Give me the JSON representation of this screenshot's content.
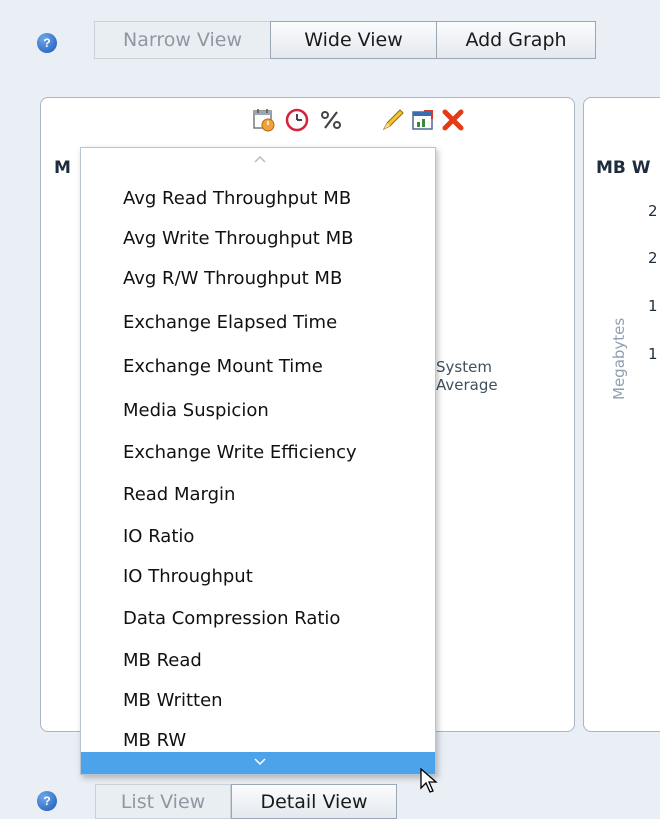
{
  "toolbar": {
    "help": "?",
    "narrow_view": "Narrow View",
    "wide_view": "Wide View",
    "add_graph": "Add Graph"
  },
  "left_panel": {
    "title_fragment": "M"
  },
  "right_panel": {
    "title_fragment": "MB W",
    "axis_label": "Megabytes",
    "tick_values": [
      "2",
      "2",
      "1",
      "1"
    ]
  },
  "legend_fragment": {
    "line1": "System",
    "line2": "Average"
  },
  "icons": [
    "calendar-icon",
    "clock-icon",
    "percent-icon",
    "pencil-icon",
    "export-icon",
    "delete-icon"
  ],
  "dropdown": {
    "scroll_up": "^",
    "scroll_down": "v",
    "items": [
      "Avg Read Throughput MB",
      "Avg Write Throughput MB",
      "Avg R/W Throughput MB",
      "Exchange Elapsed Time",
      "Exchange Mount Time",
      "Media Suspicion",
      "Exchange Write Efficiency",
      "Read Margin",
      "IO Ratio",
      "IO Throughput",
      "Data Compression Ratio",
      "MB Read",
      "MB Written",
      "MB RW"
    ]
  },
  "bottom_tabs": {
    "list_view": "List View",
    "detail_view": "Detail View"
  },
  "colors": {
    "accent": "#4da3ea",
    "background": "#e9eff5",
    "panel_border": "#a9b6c3",
    "delete": "#e23b16"
  }
}
